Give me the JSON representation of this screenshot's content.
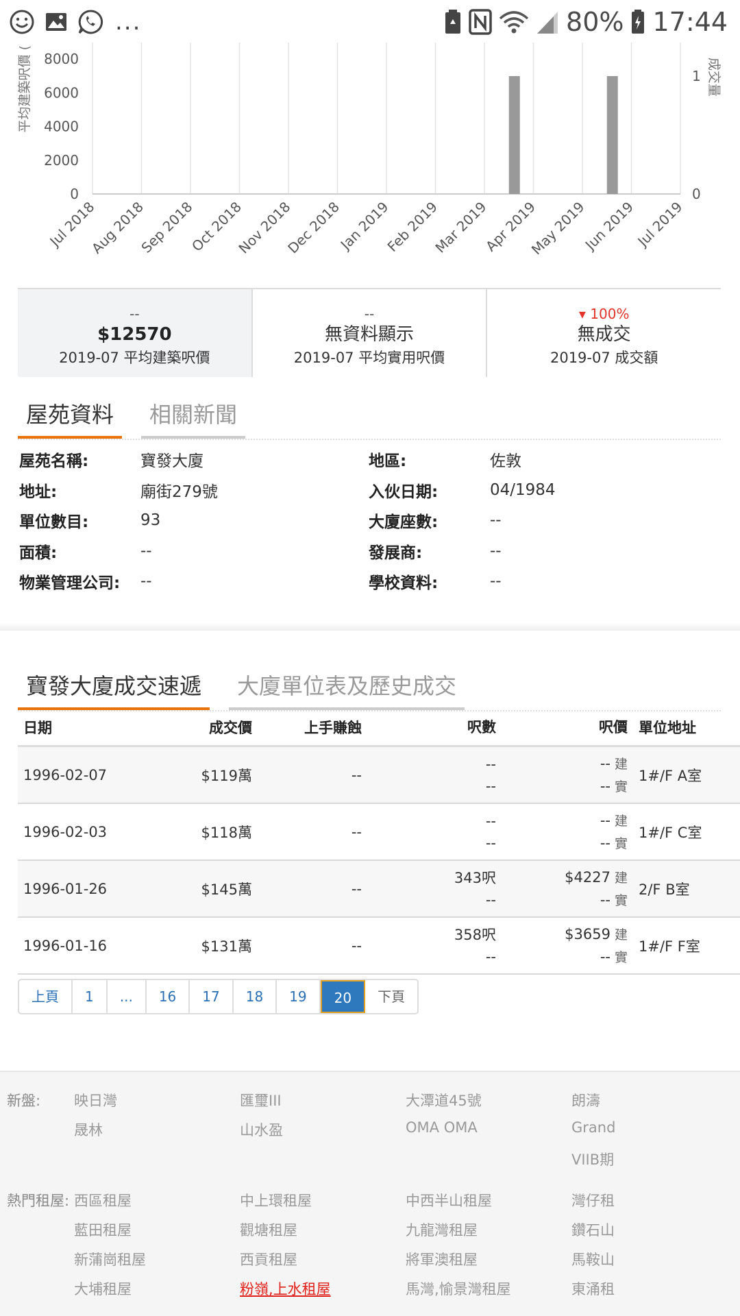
{
  "status_bar": {
    "icons_left": [
      "smiley-icon",
      "gallery-icon",
      "whatsapp-icon"
    ],
    "overflow": "...",
    "icons_right": [
      "recycle-battery-icon",
      "nfc-icon",
      "wifi-icon",
      "signal-icon",
      "battery-icon"
    ],
    "battery": "80%",
    "time": "17:44"
  },
  "chart_data": {
    "type": "bar",
    "x": [
      "Jul 2018",
      "Aug 2018",
      "Sep 2018",
      "Oct 2018",
      "Nov 2018",
      "Dec 2018",
      "Jan 2019",
      "Feb 2019",
      "Mar 2019",
      "Apr 2019",
      "May 2019",
      "Jun 2019",
      "Jul 2019"
    ],
    "ylabel_left": "平均建築呎價 (",
    "ylabel_right": "成交量",
    "y_left_ticks": [
      "8000",
      "6000",
      "4000",
      "2000",
      "0"
    ],
    "y_right_ticks": [
      "1",
      "0"
    ],
    "series": [
      {
        "name": "成交量",
        "axis": "right",
        "values": [
          0,
          0,
          0,
          0,
          0,
          0,
          0,
          0,
          0,
          1,
          0,
          1,
          0
        ]
      }
    ],
    "ylim_left": [
      0,
      8000
    ],
    "ylim_right": [
      0,
      1
    ],
    "grid": true,
    "bar_color": "#999999"
  },
  "stats": [
    {
      "change": "--",
      "value": "$12570",
      "label": "2019-07 平均建築呎價"
    },
    {
      "change": "--",
      "value": "無資料顯示",
      "label": "2019-07 平均實用呎價"
    },
    {
      "change": "100%",
      "value": "無成交",
      "label": "2019-07 成交額"
    }
  ],
  "info_tabs": [
    "屋苑資料",
    "相關新聞"
  ],
  "info": {
    "rows": [
      {
        "k1": "屋苑名稱:",
        "v1": "寶發大廈",
        "k2": "地區:",
        "v2": "佐敦"
      },
      {
        "k1": "地址:",
        "v1": "廟街279號",
        "k2": "入伙日期:",
        "v2": "04/1984"
      },
      {
        "k1": "單位數目:",
        "v1": "93",
        "k2": "大廈座數:",
        "v2": "--"
      },
      {
        "k1": "面積:",
        "v1": "--",
        "k2": "發展商:",
        "v2": "--"
      },
      {
        "k1": "物業管理公司:",
        "v1": "--",
        "k2": "學校資料:",
        "v2": "--"
      }
    ]
  },
  "tx_tabs": [
    "寶發大廈成交速遞",
    "大廈單位表及歷史成交"
  ],
  "tx_table": {
    "headers": [
      "日期",
      "成交價",
      "上手賺蝕",
      "呎數",
      "呎價",
      "單位地址"
    ],
    "tag_gross": "建",
    "tag_net": "實",
    "rows": [
      {
        "date": "1996-02-07",
        "price": "$119萬",
        "prev": "--",
        "area_gross": "--",
        "area_net": "--",
        "pp_gross": "--",
        "pp_net": "--",
        "addr": "1#/F A室"
      },
      {
        "date": "1996-02-03",
        "price": "$118萬",
        "prev": "--",
        "area_gross": "--",
        "area_net": "--",
        "pp_gross": "--",
        "pp_net": "--",
        "addr": "1#/F C室"
      },
      {
        "date": "1996-01-26",
        "price": "$145萬",
        "prev": "--",
        "area_gross": "343呎",
        "area_net": "--",
        "pp_gross": "$4227",
        "pp_net": "--",
        "addr": "2/F B室"
      },
      {
        "date": "1996-01-16",
        "price": "$131萬",
        "prev": "--",
        "area_gross": "358呎",
        "area_net": "--",
        "pp_gross": "$3659",
        "pp_net": "--",
        "addr": "1#/F F室"
      }
    ]
  },
  "pagination": {
    "prev": "上頁",
    "pages": [
      "1",
      "...",
      "16",
      "17",
      "18",
      "19",
      "20"
    ],
    "current": "20",
    "next": "下頁"
  },
  "footer": {
    "new_label": "新盤:",
    "new_links": [
      [
        "映日灣",
        "匯璽III",
        "大潭道45號",
        "朗濤"
      ],
      [
        "晟林",
        "山水盈",
        "OMA OMA",
        "Grand"
      ],
      [
        "",
        "",
        "",
        "VIIB期"
      ]
    ],
    "rent_label": "熱門租屋:",
    "rent_links": [
      [
        "西區租屋",
        "中上環租屋",
        "中西半山租屋",
        "灣仔租"
      ],
      [
        "藍田租屋",
        "觀塘租屋",
        "九龍灣租屋",
        "鑽石山"
      ],
      [
        "新蒲崗租屋",
        "西貢租屋",
        "將軍澳租屋",
        "馬鞍山"
      ],
      [
        "大埔租屋",
        "粉嶺,上水租屋",
        "馬灣,愉景灣租屋",
        "東涌租"
      ]
    ],
    "highlight": "粉嶺,上水租屋"
  }
}
